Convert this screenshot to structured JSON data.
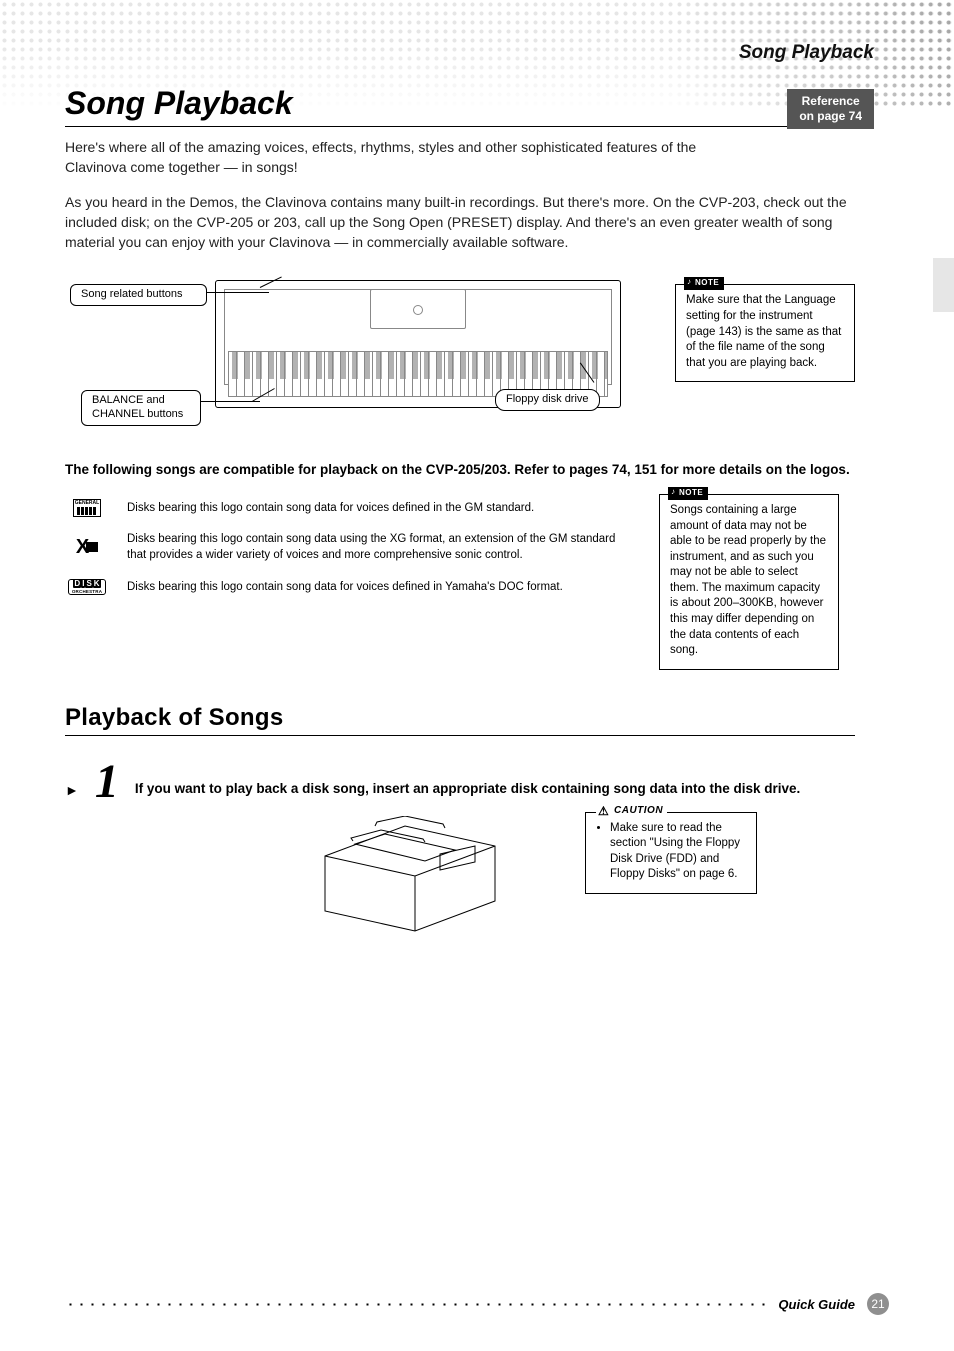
{
  "header": {
    "section_title": "Song Playback",
    "reference_line1": "Reference",
    "reference_line2": "on page 74"
  },
  "title": "Song Playback",
  "intro_p1": "Here's where all of the amazing voices, effects, rhythms, styles and other sophisticated features of the Clavinova come together — in songs!",
  "intro_p2": "As you heard in the Demos, the Clavinova contains many built-in recordings. But there's more. On the CVP-203, check out the included disk; on the CVP-205 or 203, call up the Song Open (PRESET) display. And there's an even greater wealth of song material you can enjoy with your Clavinova — in commercially available software.",
  "diagram": {
    "song_label": "Song related buttons",
    "balance_label_line1": "BALANCE and",
    "balance_label_line2": "CHANNEL buttons",
    "fdd_label": "Floppy disk drive"
  },
  "note1": {
    "label": "NOTE",
    "text": "Make sure that the Language setting for the instrument (page 143) is the same as that of the file name of the song that you are playing back."
  },
  "compat_intro": "The following songs are compatible for playback on the CVP-205/203. Refer to pages 74, 151 for more details on the logos.",
  "logos": [
    {
      "name": "GENERAL MIDI",
      "desc": "Disks bearing this logo contain song data for voices defined in the GM standard."
    },
    {
      "name": "XG",
      "desc": "Disks bearing this logo contain song data using the XG format, an extension of the GM standard that provides a wider variety of voices and more comprehensive sonic control."
    },
    {
      "name": "DISK ORCHESTRA",
      "desc": "Disks bearing this logo contain song data for voices defined in Yamaha's DOC format."
    }
  ],
  "note2": {
    "label": "NOTE",
    "text": "Songs containing a large amount of data may not be able to be read properly by the instrument, and as such you may not be able to select them. The maximum capacity is about 200–300KB, however this may differ depending on the data contents of each song."
  },
  "sub_title": "Playback of Songs",
  "step1": {
    "num": "1",
    "text": "If you want to play back a disk song, insert an appropriate disk containing song data into the disk drive."
  },
  "caution": {
    "label": "CAUTION",
    "item": "Make sure to read the section \"Using the Floppy Disk Drive (FDD) and Floppy Disks\" on page 6."
  },
  "footer": {
    "label": "Quick Guide",
    "page": "21"
  }
}
